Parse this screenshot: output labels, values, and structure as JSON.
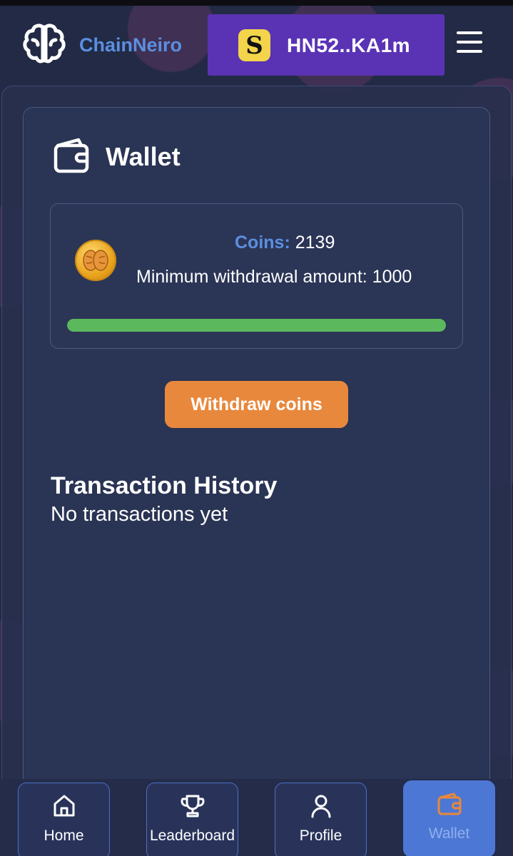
{
  "header": {
    "brand": "ChainNeiro",
    "wallet_address": "HN52..KA1m",
    "wallet_icon_letter": "S",
    "colors": {
      "brand": "#5b8fe0",
      "chip_bg": "#5a33b5",
      "chip_icon_bg": "#f3d44a"
    }
  },
  "wallet": {
    "title": "Wallet",
    "coins_label": "Coins:",
    "coins_value": "2139",
    "min_withdrawal_text": "Minimum withdrawal amount: 1000",
    "progress_fraction": 1.0,
    "progress_color": "#5cb85c",
    "withdraw_label": "Withdraw coins",
    "withdraw_color": "#e8883c"
  },
  "history": {
    "title": "Transaction History",
    "empty_text": "No transactions yet"
  },
  "nav": {
    "items": [
      {
        "label": "Home",
        "icon": "home-icon"
      },
      {
        "label": "Leaderboard",
        "icon": "trophy-icon"
      },
      {
        "label": "Profile",
        "icon": "user-icon"
      },
      {
        "label": "Wallet",
        "icon": "wallet-icon",
        "active": true
      }
    ],
    "active_color": "#4d77d4",
    "active_icon_color": "#e8883c"
  }
}
